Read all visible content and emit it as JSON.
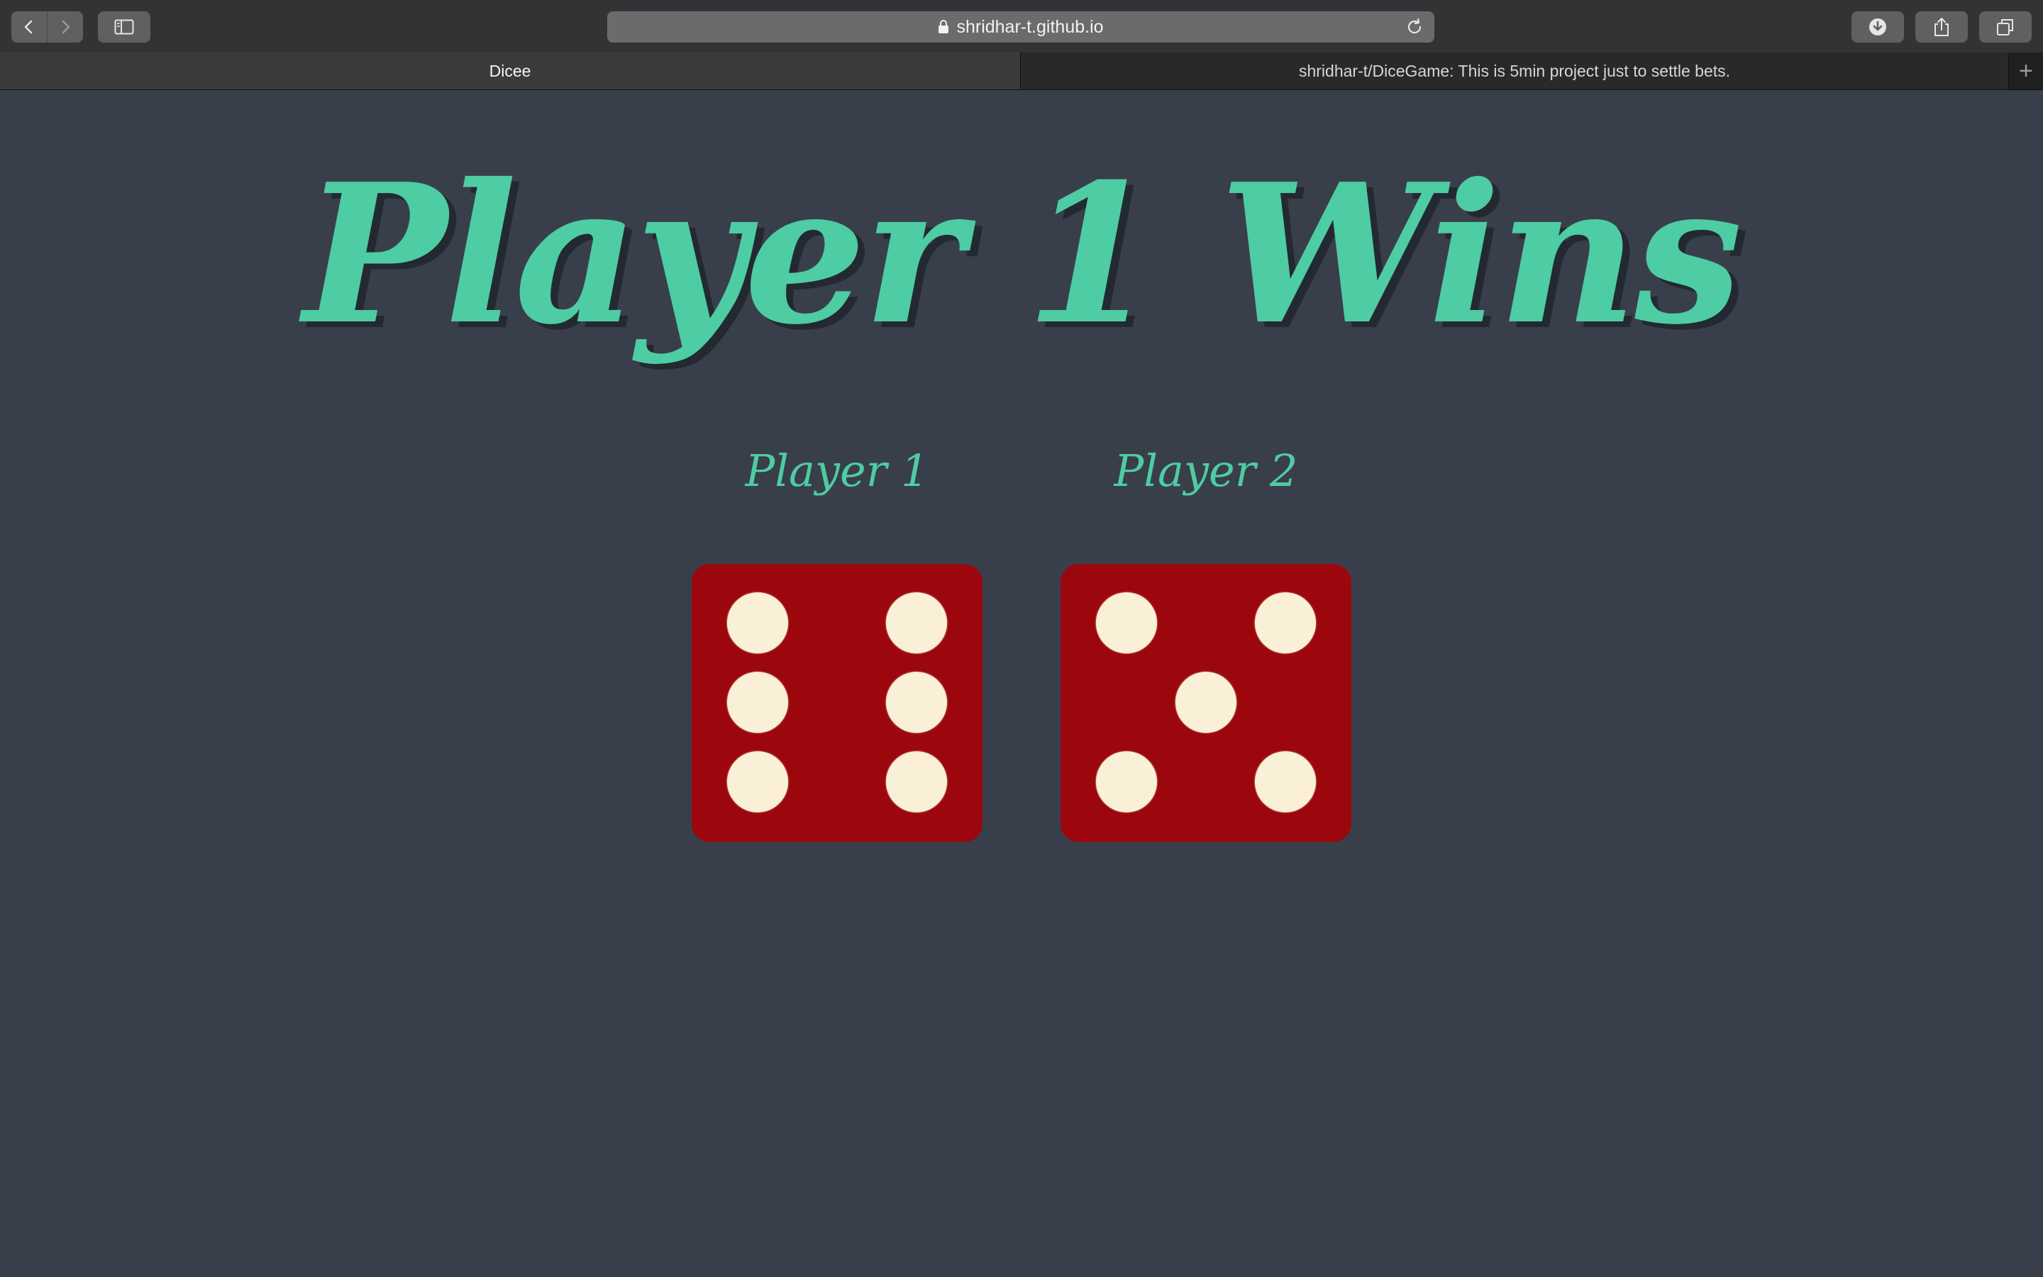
{
  "browser": {
    "address": "shridhar-t.github.io",
    "tabs": [
      {
        "label": "Dicee",
        "active": true
      },
      {
        "label": "shridhar-t/DiceGame: This is 5min project just to settle bets.",
        "active": false
      }
    ],
    "new_tab_label": "+"
  },
  "game": {
    "headline": "Player 1 Wins",
    "players": [
      {
        "label": "Player 1",
        "die_value": 6
      },
      {
        "label": "Player 2",
        "die_value": 5
      }
    ]
  },
  "colors": {
    "accent": "#4ecca3",
    "background": "#393f4a",
    "die": "#9b070d",
    "pip": "#faf0d7"
  }
}
